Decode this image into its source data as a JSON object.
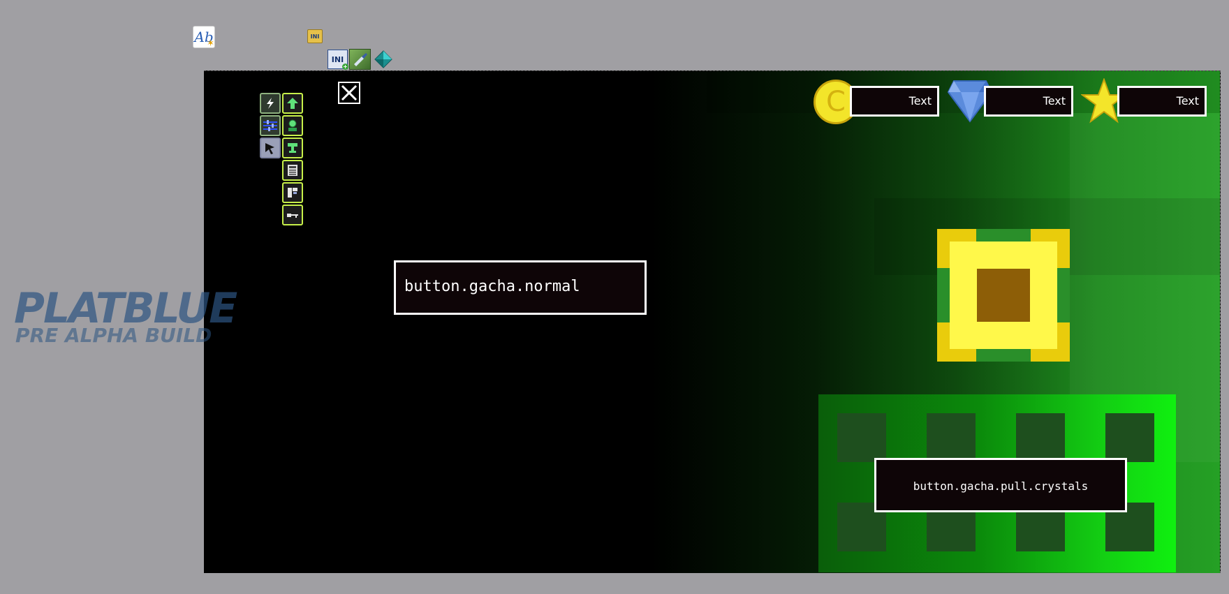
{
  "editor": {
    "object_icons": [
      "text-object-icon",
      "ini-folder-icon",
      "ini-object-icon",
      "paint-object-icon",
      "gem-object-icon"
    ],
    "ini_folder_label": "INI",
    "ini_box_label": "INI",
    "text_icon_label": "Ab"
  },
  "toolbar": {
    "tools": [
      "lightning-icon",
      "arrow-up-icon",
      "sliders-icon",
      "user-icon",
      "cursor-icon",
      "trophy-icon",
      "calculator-icon",
      "signpost-icon",
      "key-icon"
    ]
  },
  "currency": {
    "coin_label": "Text",
    "gem_label": "Text",
    "star_label": "Text",
    "coin_symbol": "C"
  },
  "gacha": {
    "normal_label": "button.gacha.normal",
    "pull_label": "button.gacha.pull.crystals"
  },
  "watermark": {
    "title": "PLATBLUE",
    "subtitle": "PRE ALPHA BUILD"
  },
  "colors": {
    "background": "#a09fa3",
    "coin": "#f3e52a",
    "gem": "#5b8bdc",
    "chest_outer": "#e9cc0c",
    "chest_inner": "#fff84a",
    "chest_core": "#8d5e07",
    "tool_border": "#c7f04a"
  }
}
